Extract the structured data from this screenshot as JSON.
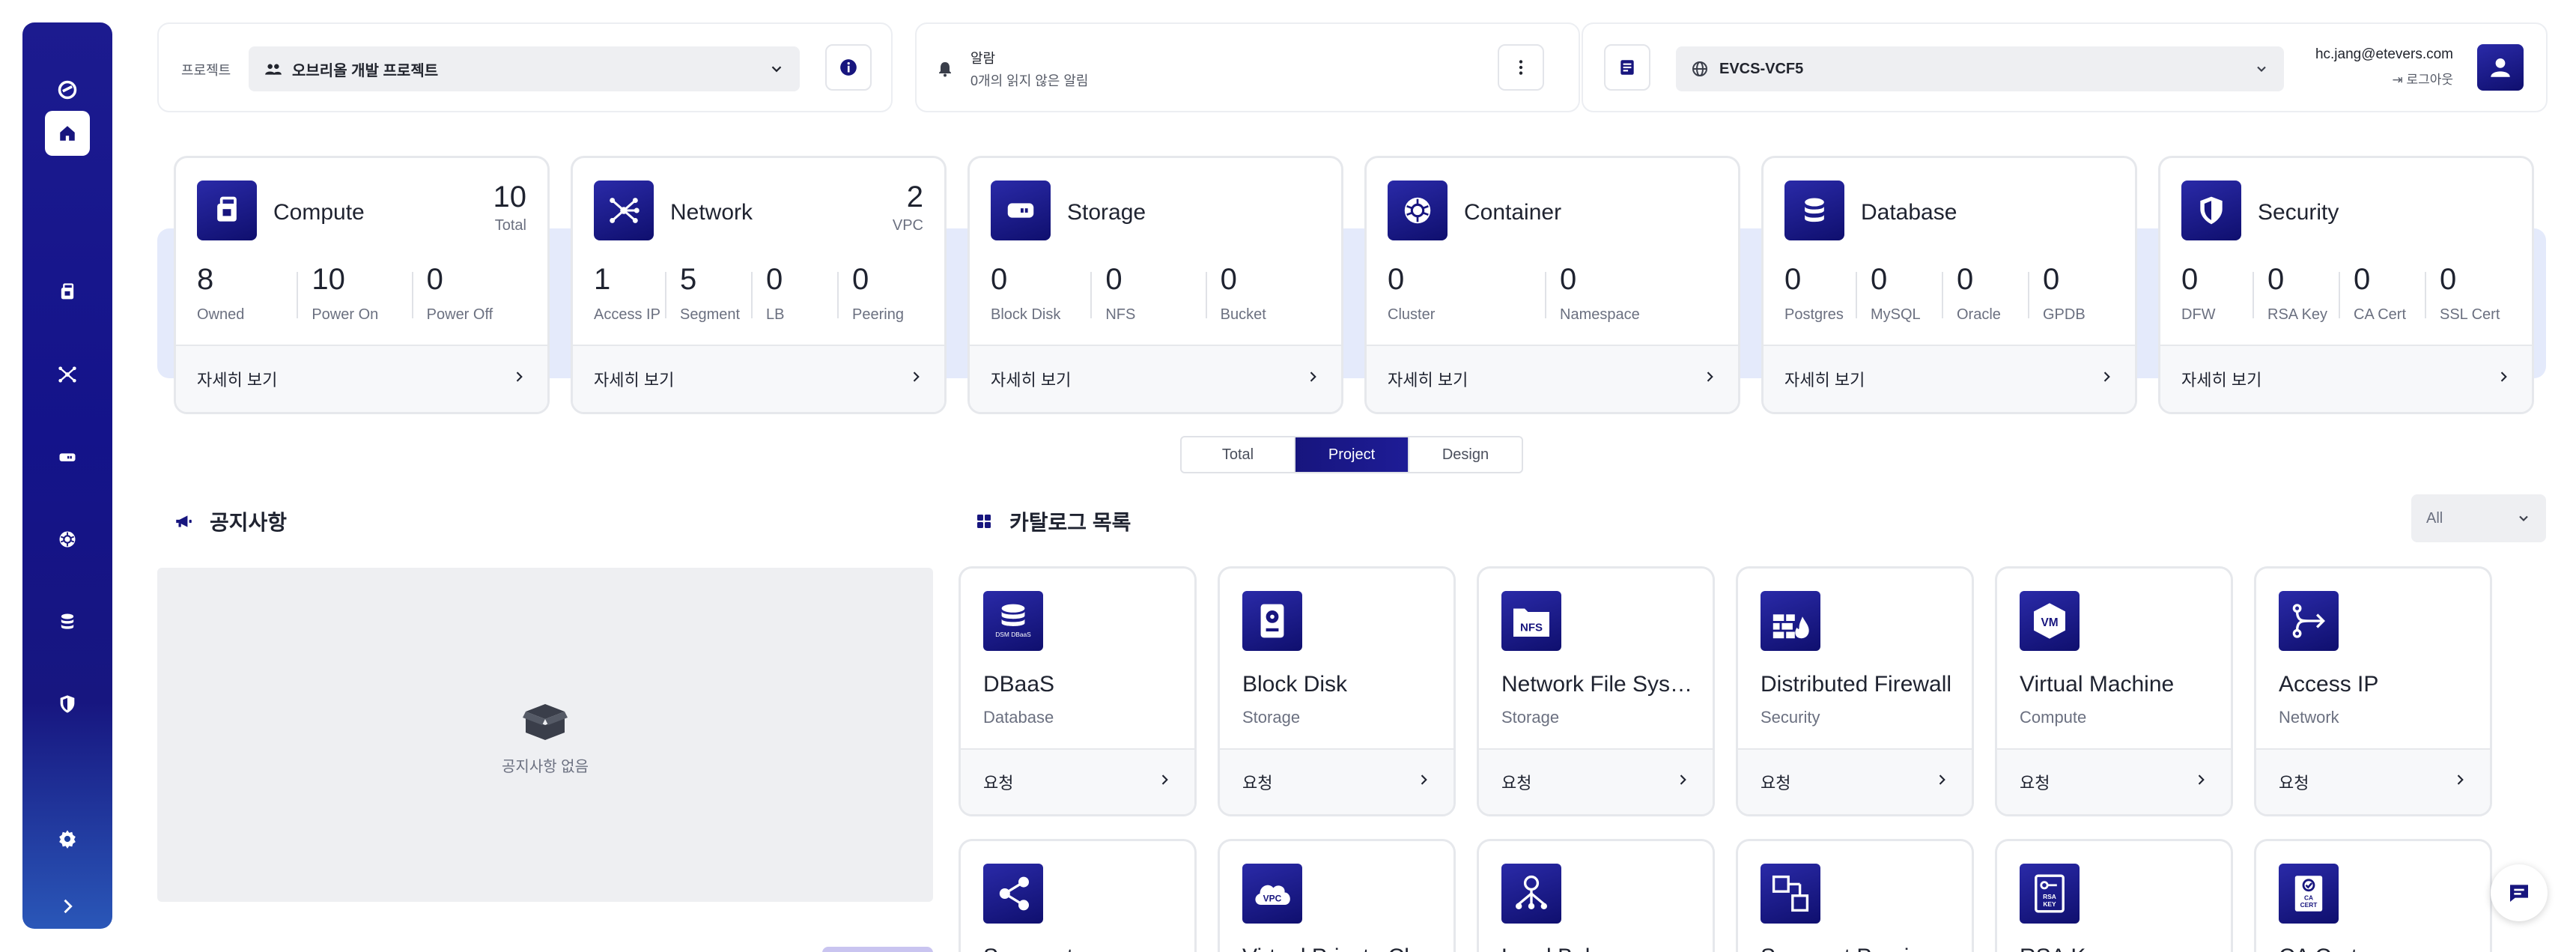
{
  "colors": {
    "brand": "#17157e",
    "brand_light": "#2a2aa8",
    "band": "#e4eafb"
  },
  "sidebar": {
    "items": [
      {
        "name": "logo-icon"
      },
      {
        "name": "home-icon"
      },
      {
        "name": "compute-icon"
      },
      {
        "name": "network-icon"
      },
      {
        "name": "storage-icon"
      },
      {
        "name": "container-icon"
      },
      {
        "name": "database-icon"
      },
      {
        "name": "security-icon"
      },
      {
        "name": "settings-icon"
      },
      {
        "name": "chevron-right-icon"
      }
    ]
  },
  "header": {
    "project_label": "프로젝트",
    "project_value": "오브리올 개발 프로젝트",
    "alert_title": "알람",
    "alert_sub": "0개의 읽지 않은 알림",
    "region_value": "EVCS-VCF5",
    "user_email": "hc.jang@etevers.com",
    "logout_label": "로그아웃"
  },
  "resources": [
    {
      "title": "Compute",
      "total": "10",
      "total_label": "Total",
      "metrics": [
        {
          "n": "8",
          "t": "Owned"
        },
        {
          "n": "10",
          "t": "Power On"
        },
        {
          "n": "0",
          "t": "Power Off"
        }
      ],
      "footer": "자세히 보기"
    },
    {
      "title": "Network",
      "total": "2",
      "total_label": "VPC",
      "metrics": [
        {
          "n": "1",
          "t": "Access IP"
        },
        {
          "n": "5",
          "t": "Segment"
        },
        {
          "n": "0",
          "t": "LB"
        },
        {
          "n": "0",
          "t": "Peering"
        }
      ],
      "footer": "자세히 보기"
    },
    {
      "title": "Storage",
      "total": "",
      "total_label": "",
      "metrics": [
        {
          "n": "0",
          "t": "Block Disk"
        },
        {
          "n": "0",
          "t": "NFS"
        },
        {
          "n": "0",
          "t": "Bucket"
        }
      ],
      "footer": "자세히 보기"
    },
    {
      "title": "Container",
      "total": "",
      "total_label": "",
      "metrics": [
        {
          "n": "0",
          "t": "Cluster"
        },
        {
          "n": "0",
          "t": "Namespace"
        }
      ],
      "footer": "자세히 보기"
    },
    {
      "title": "Database",
      "total": "",
      "total_label": "",
      "metrics": [
        {
          "n": "0",
          "t": "Postgres"
        },
        {
          "n": "0",
          "t": "MySQL"
        },
        {
          "n": "0",
          "t": "Oracle"
        },
        {
          "n": "0",
          "t": "GPDB"
        }
      ],
      "footer": "자세히 보기"
    },
    {
      "title": "Security",
      "total": "",
      "total_label": "",
      "metrics": [
        {
          "n": "0",
          "t": "DFW"
        },
        {
          "n": "0",
          "t": "RSA Key"
        },
        {
          "n": "0",
          "t": "CA Cert"
        },
        {
          "n": "0",
          "t": "SSL Cert"
        }
      ],
      "footer": "자세히 보기"
    }
  ],
  "toggle": {
    "options": [
      "Total",
      "Project",
      "Design"
    ],
    "active": "Project"
  },
  "notices": {
    "title": "공지사항",
    "empty": "공지사항 없음"
  },
  "catalog": {
    "title": "카탈로그 목록",
    "filter": "All",
    "items": [
      {
        "name": "DBaaS",
        "category": "Database",
        "action": "요청",
        "icon": "dbaas-icon",
        "icon_text": "DSM DBaaS"
      },
      {
        "name": "Block Disk",
        "category": "Storage",
        "action": "요청",
        "icon": "block-disk-icon",
        "icon_text": ""
      },
      {
        "name": "Network File System",
        "category": "Storage",
        "action": "요청",
        "icon": "nfs-icon",
        "icon_text": "NFS"
      },
      {
        "name": "Distributed Firewall",
        "category": "Security",
        "action": "요청",
        "icon": "firewall-icon",
        "icon_text": ""
      },
      {
        "name": "Virtual Machine",
        "category": "Compute",
        "action": "요청",
        "icon": "vm-icon",
        "icon_text": "VM"
      },
      {
        "name": "Access IP",
        "category": "Network",
        "action": "요청",
        "icon": "access-ip-icon",
        "icon_text": ""
      },
      {
        "name": "Segment",
        "category": "",
        "action": "",
        "icon": "segment-icon",
        "icon_text": ""
      },
      {
        "name": "Virtual Private Cloud",
        "category": "",
        "action": "",
        "icon": "vpc-icon",
        "icon_text": "VPC"
      },
      {
        "name": "Load Balancer",
        "category": "",
        "action": "",
        "icon": "load-balancer-icon",
        "icon_text": ""
      },
      {
        "name": "Segment Peering",
        "category": "",
        "action": "",
        "icon": "peering-icon",
        "icon_text": ""
      },
      {
        "name": "RSA Key",
        "category": "",
        "action": "",
        "icon": "rsa-key-icon",
        "icon_text": "RSA KEY"
      },
      {
        "name": "CA Cert",
        "category": "",
        "action": "",
        "icon": "ca-cert-icon",
        "icon_text": "CA CERT"
      }
    ]
  }
}
